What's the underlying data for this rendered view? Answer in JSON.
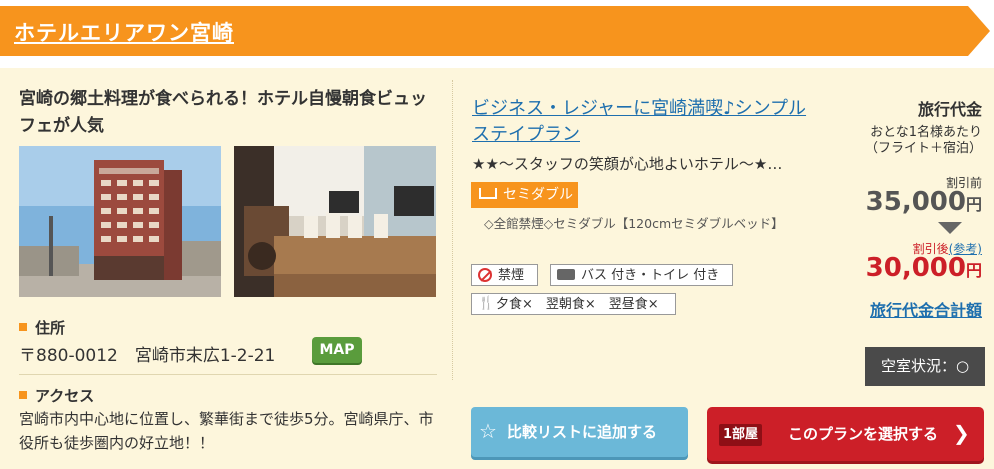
{
  "hotel": {
    "name": "ホテルエリアワン宮崎",
    "catch": "宮崎の郷土料理が食べられる！ホテル自慢朝食ビュッフェが人気"
  },
  "address": {
    "heading": "住所",
    "text": "〒880-0012　宮崎市末広1-2-21",
    "map_label": "MAP"
  },
  "access": {
    "heading": "アクセス",
    "text": "宮崎市内中心地に位置し、繁華街まで徒歩5分。宮崎県庁、市役所も徒歩圏内の好立地！！"
  },
  "plan": {
    "title": "ビジネス・レジャーに宮崎満喫♪シンプルステイプラン",
    "subtitle": "★★～スタッフの笑顔が心地よいホテル～★…",
    "room_type": "セミダブル",
    "room_desc": "◇全館禁煙◇セミダブル【120cmセミダブルベッド】",
    "tags": {
      "smoking": "禁煙",
      "bath": "バス 付き・トイレ 付き",
      "meals": "夕食×　翌朝食×　翌昼食×"
    }
  },
  "price": {
    "label": "旅行代金",
    "cond1": "おとな1名様あたり",
    "cond2": "（フライト＋宿泊）",
    "before_label": "割引前",
    "before_value": "35,000",
    "after_label": "割引後",
    "after_ref": "(参考)",
    "after_value": "30,000",
    "yen": "円",
    "total_link": "旅行代金合計額"
  },
  "vacancy": "空室状況：○",
  "actions": {
    "compare": "比較リストに追加する",
    "room_count": "1部屋",
    "select": "このプランを選択する"
  },
  "colors": {
    "accent": "#f7941d",
    "panel": "#fdf6dc",
    "link": "#1e6fae",
    "price_red": "#cc1f28"
  }
}
